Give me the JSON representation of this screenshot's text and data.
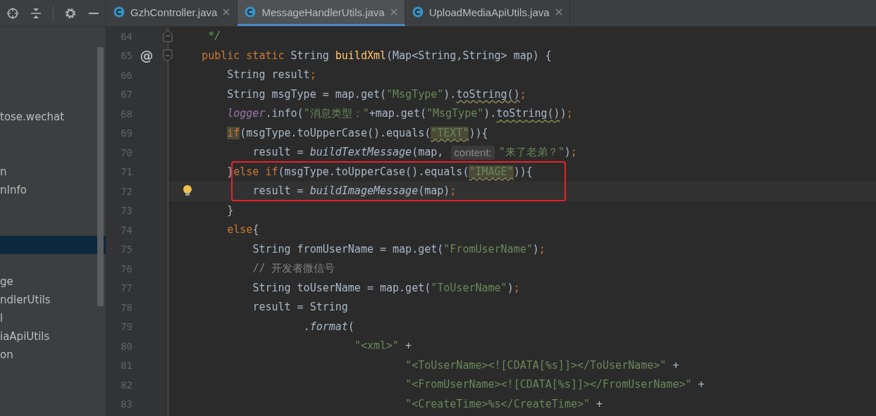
{
  "sidebar": {
    "items": [
      {
        "selected": false
      },
      {
        "selected": false
      },
      {
        "selected": false
      },
      {
        "selected": false
      },
      {
        "label": "tose.wechat",
        "selected": false
      },
      {
        "selected": false
      },
      {
        "selected": false
      },
      {
        "label": "n",
        "selected": false
      },
      {
        "label": "nInfo",
        "selected": false
      },
      {
        "selected": false
      },
      {
        "selected": false
      },
      {
        "selected": true
      },
      {
        "selected": false
      },
      {
        "label": "ge",
        "selected": false
      },
      {
        "label": "ndlerUtils",
        "selected": false
      },
      {
        "label": "l",
        "selected": false
      },
      {
        "label": "iaApiUtils",
        "selected": false
      },
      {
        "label": "on",
        "selected": false
      }
    ]
  },
  "tabs": [
    {
      "label": "GzhController.java",
      "selected": false
    },
    {
      "label": "MessageHandlerUtils.java",
      "selected": true
    },
    {
      "label": "UploadMediaApiUtils.java",
      "selected": false
    }
  ],
  "editor": {
    "lines": [
      {
        "number": "64",
        "fold_end": true,
        "current": false,
        "boxed": false,
        "tokens": [
          {
            "kind": "doc",
            "text": "     */"
          }
        ]
      },
      {
        "number": "65",
        "fold_start": true,
        "marker": "@",
        "current": false,
        "boxed": false,
        "tokens": [
          {
            "kind": "keyword",
            "text": "    public static "
          },
          {
            "kind": "plain",
            "text": "String "
          },
          {
            "kind": "decl",
            "text": "buildXml"
          },
          {
            "kind": "plain",
            "text": "(Map<String,String> map) {"
          }
        ]
      },
      {
        "number": "66",
        "current": false,
        "boxed": false,
        "tokens": [
          {
            "kind": "plain",
            "text": "        String result"
          },
          {
            "kind": "keyword",
            "text": ";"
          }
        ]
      },
      {
        "number": "67",
        "current": false,
        "boxed": false,
        "tokens": [
          {
            "kind": "plain",
            "text": "        String msgType = map.get("
          },
          {
            "kind": "string",
            "text": "\"MsgType\""
          },
          {
            "kind": "plain",
            "text": ")."
          },
          {
            "kind": "plain",
            "text": "toString()",
            "wavy": true
          },
          {
            "kind": "keyword",
            "text": ";"
          }
        ]
      },
      {
        "number": "68",
        "current": false,
        "boxed": false,
        "tokens": [
          {
            "kind": "field",
            "text": "        logger"
          },
          {
            "kind": "plain",
            "text": ".info("
          },
          {
            "kind": "string",
            "text": "\"消息类型：\""
          },
          {
            "kind": "plain",
            "text": "+map.get("
          },
          {
            "kind": "string",
            "text": "\"MsgType\""
          },
          {
            "kind": "plain",
            "text": ")."
          },
          {
            "kind": "plain",
            "text": "toString()",
            "wavy": true
          },
          {
            "kind": "plain",
            "text": ")"
          },
          {
            "kind": "keyword",
            "text": ";"
          }
        ]
      },
      {
        "number": "69",
        "current": false,
        "boxed": false,
        "tokens": [
          {
            "kind": "keyword",
            "text": "        if",
            "marked": true
          },
          {
            "kind": "plain",
            "text": "(msgType.toUpperCase().equals("
          },
          {
            "kind": "string",
            "text": "\"TEXT\"",
            "marked": true,
            "wavy": true
          },
          {
            "kind": "plain",
            "text": ")){"
          }
        ]
      },
      {
        "number": "70",
        "current": false,
        "boxed": false,
        "tokens": [
          {
            "kind": "plain",
            "text": "            result = "
          },
          {
            "kind": "call",
            "text": "buildTextMessage"
          },
          {
            "kind": "plain",
            "text": "(map, "
          },
          {
            "kind": "hint",
            "text": "content:"
          },
          {
            "kind": "string",
            "text": "\"来了老弟？\""
          },
          {
            "kind": "plain",
            "text": ")"
          },
          {
            "kind": "keyword",
            "text": ";"
          }
        ]
      },
      {
        "number": "71",
        "current": false,
        "boxed": true,
        "tokens": [
          {
            "kind": "plain",
            "text": "        }"
          },
          {
            "kind": "keyword",
            "text": "else if"
          },
          {
            "kind": "plain",
            "text": "(msgType.toUpperCase().equals("
          },
          {
            "kind": "string",
            "text": "\"IMAGE\"",
            "marked": true,
            "wavy": true
          },
          {
            "kind": "plain",
            "text": ")){"
          }
        ]
      },
      {
        "number": "72",
        "bulb": true,
        "current": true,
        "boxed": true,
        "tokens": [
          {
            "kind": "plain",
            "text": "            result = "
          },
          {
            "kind": "call",
            "text": "buildImageMessage"
          },
          {
            "kind": "plain",
            "text": "(map)"
          },
          {
            "kind": "keyword",
            "text": ";"
          }
        ]
      },
      {
        "number": "73",
        "current": false,
        "boxed": false,
        "tokens": [
          {
            "kind": "plain",
            "text": "        }"
          }
        ]
      },
      {
        "number": "74",
        "current": false,
        "boxed": false,
        "tokens": [
          {
            "kind": "keyword",
            "text": "        else"
          },
          {
            "kind": "plain",
            "text": "{"
          }
        ]
      },
      {
        "number": "75",
        "current": false,
        "boxed": false,
        "tokens": [
          {
            "kind": "plain",
            "text": "            String fromUserName = map.get("
          },
          {
            "kind": "string",
            "text": "\"FromUserName\""
          },
          {
            "kind": "plain",
            "text": ")"
          },
          {
            "kind": "keyword",
            "text": ";"
          }
        ]
      },
      {
        "number": "76",
        "current": false,
        "boxed": false,
        "tokens": [
          {
            "kind": "comment",
            "text": "            // 开发者微信号"
          }
        ]
      },
      {
        "number": "77",
        "current": false,
        "boxed": false,
        "tokens": [
          {
            "kind": "plain",
            "text": "            String toUserName = map.get("
          },
          {
            "kind": "string",
            "text": "\"ToUserName\""
          },
          {
            "kind": "plain",
            "text": ")"
          },
          {
            "kind": "keyword",
            "text": ";"
          }
        ]
      },
      {
        "number": "78",
        "current": false,
        "boxed": false,
        "tokens": [
          {
            "kind": "plain",
            "text": "            result = String"
          }
        ]
      },
      {
        "number": "79",
        "current": false,
        "boxed": false,
        "tokens": [
          {
            "kind": "plain",
            "text": "                    ."
          },
          {
            "kind": "call",
            "text": "format"
          },
          {
            "kind": "plain",
            "text": "("
          }
        ]
      },
      {
        "number": "80",
        "current": false,
        "boxed": false,
        "tokens": [
          {
            "kind": "string",
            "text": "                            \"<xml>\""
          },
          {
            "kind": "plain",
            "text": " +"
          }
        ]
      },
      {
        "number": "81",
        "current": false,
        "boxed": false,
        "tokens": [
          {
            "kind": "string",
            "text": "                                    \"<ToUserName><![CDATA[%s]]></ToUserName>\""
          },
          {
            "kind": "plain",
            "text": " +"
          }
        ]
      },
      {
        "number": "82",
        "current": false,
        "boxed": false,
        "tokens": [
          {
            "kind": "string",
            "text": "                                    \"<FromUserName><![CDATA[%s]]></FromUserName>\""
          },
          {
            "kind": "plain",
            "text": " +"
          }
        ]
      },
      {
        "number": "83",
        "current": false,
        "boxed": false,
        "tokens": [
          {
            "kind": "string",
            "text": "                                    \"<CreateTime>%s</CreateTime>\""
          },
          {
            "kind": "plain",
            "text": " +"
          }
        ]
      }
    ]
  }
}
